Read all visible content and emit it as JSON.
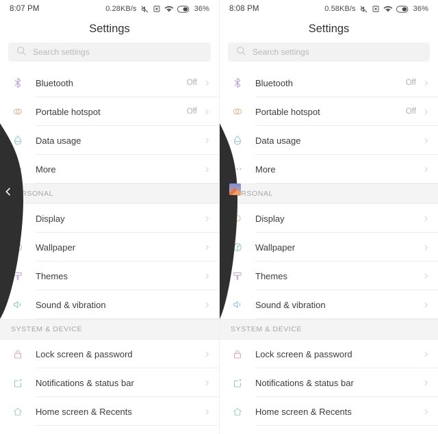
{
  "panels": [
    {
      "id": "left",
      "statusbar": {
        "time": "8:07 PM",
        "net_rate": "0.28KB/s",
        "mute_icon": "mute-icon",
        "alarm_icon": "alarm-icon",
        "wifi_icon": "wifi-icon",
        "battery_icon": "battery-icon",
        "battery_pct": "36%"
      },
      "title": "Settings",
      "search": {
        "placeholder": "Search settings",
        "icon": "search-icon"
      },
      "has_back_chevron": true,
      "has_thumbnail": false,
      "curl_width": 34,
      "rows": [
        {
          "label": "Bluetooth",
          "value": "Off",
          "icon": "bluetooth-icon",
          "color": "#b69de0"
        },
        {
          "label": "Portable hotspot",
          "value": "Off",
          "icon": "hotspot-icon",
          "color": "#e3b98d"
        },
        {
          "label": "Data usage",
          "value": "",
          "icon": "data-usage-icon",
          "color": "#8ecad4"
        },
        {
          "label": "More",
          "value": "",
          "icon": "more-icon",
          "color": "#9fc6e8"
        }
      ],
      "section_personal": "PERSONAL",
      "personal_rows": [
        {
          "label": "Display",
          "value": "",
          "icon": "display-icon",
          "color": "#eab98f"
        },
        {
          "label": "Wallpaper",
          "value": "",
          "icon": "wallpaper-icon",
          "color": "#8fc9bf"
        },
        {
          "label": "Themes",
          "value": "",
          "icon": "themes-icon",
          "color": "#c0a3dd"
        },
        {
          "label": "Sound & vibration",
          "value": "",
          "icon": "sound-icon",
          "color": "#89c4d0"
        }
      ],
      "section_system": "SYSTEM & DEVICE",
      "system_rows": [
        {
          "label": "Lock screen & password",
          "value": "",
          "icon": "lock-icon",
          "color": "#e8a3ad"
        },
        {
          "label": "Notifications & status bar",
          "value": "",
          "icon": "notifications-icon",
          "color": "#8fc9c4"
        },
        {
          "label": "Home screen & Recents",
          "value": "",
          "icon": "home-icon",
          "color": "#9ed0c0"
        }
      ]
    },
    {
      "id": "right",
      "statusbar": {
        "time": "8:08 PM",
        "net_rate": "0.58KB/s",
        "mute_icon": "mute-icon",
        "alarm_icon": "alarm-icon",
        "wifi_icon": "wifi-icon",
        "battery_icon": "battery-icon",
        "battery_pct": "36%"
      },
      "title": "Settings",
      "search": {
        "placeholder": "Search settings",
        "icon": "search-icon"
      },
      "has_back_chevron": false,
      "has_thumbnail": true,
      "curl_width": 26,
      "rows": [
        {
          "label": "Bluetooth",
          "value": "Off",
          "icon": "bluetooth-icon",
          "color": "#b69de0"
        },
        {
          "label": "Portable hotspot",
          "value": "Off",
          "icon": "hotspot-icon",
          "color": "#e3b98d"
        },
        {
          "label": "Data usage",
          "value": "",
          "icon": "data-usage-icon",
          "color": "#8ecad4"
        },
        {
          "label": "More",
          "value": "",
          "icon": "more-icon",
          "color": "#9fc6e8"
        }
      ],
      "section_personal": "PERSONAL",
      "personal_rows": [
        {
          "label": "Display",
          "value": "",
          "icon": "display-icon",
          "color": "#eab98f"
        },
        {
          "label": "Wallpaper",
          "value": "",
          "icon": "wallpaper-icon",
          "color": "#8fc9bf"
        },
        {
          "label": "Themes",
          "value": "",
          "icon": "themes-icon",
          "color": "#c0a3dd"
        },
        {
          "label": "Sound & vibration",
          "value": "",
          "icon": "sound-icon",
          "color": "#89c4d0"
        }
      ],
      "section_system": "SYSTEM & DEVICE",
      "system_rows": [
        {
          "label": "Lock screen & password",
          "value": "",
          "icon": "lock-icon",
          "color": "#e8a3ad"
        },
        {
          "label": "Notifications & status bar",
          "value": "",
          "icon": "notifications-icon",
          "color": "#8fc9c4"
        },
        {
          "label": "Home screen & Recents",
          "value": "",
          "icon": "home-icon",
          "color": "#9ed0c0"
        }
      ]
    }
  ],
  "colors": {
    "curl": "#2f2f2f",
    "chevron": "#cfcfcf",
    "section_bg": "#f4f4f4",
    "search_bg": "#f2f2f2"
  }
}
